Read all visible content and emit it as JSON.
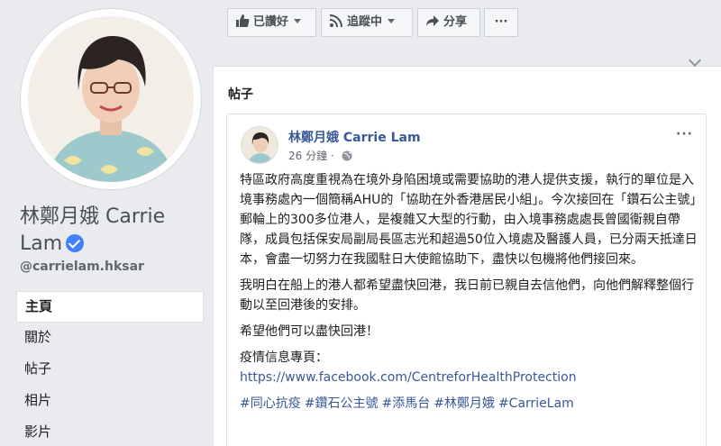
{
  "profile": {
    "name": "林鄭月娥 Carrie Lam",
    "name_line1": "林鄭月娥 Carrie",
    "name_line2": "Lam",
    "handle": "@carrielam.hksar"
  },
  "nav": {
    "items": [
      {
        "label": "主頁",
        "active": true
      },
      {
        "label": "關於"
      },
      {
        "label": "帖子"
      },
      {
        "label": "相片"
      },
      {
        "label": "影片"
      }
    ]
  },
  "actions": {
    "liked_label": "已讚好",
    "following_label": "追蹤中",
    "share_label": "分享",
    "more_label": "···"
  },
  "feed": {
    "title": "帖子"
  },
  "post": {
    "author": "林鄭月娥 Carrie Lam",
    "time": "26 分鐘",
    "meta_separator": "·",
    "more_label": "···",
    "paragraphs": [
      "特區政府高度重視為在境外身陷困境或需要協助的港人提供支援，執行的單位是入境事務處內一個簡稱AHU的「協助在外香港居民小組」。今次接回在「鑽石公主號」郵輪上的300多位港人，是複雜又大型的行動，由入境事務處處長曾國衞親自帶隊，成員包括保安局副局長區志光和超過50位入境處及醫護人員，已分兩天抵達日本，會盡一切努力在我國駐日大使館協助下，盡快以包機將他們接回來。",
      "我明白在船上的港人都希望盡快回港，我日前已親自去信他們，向他們解釋整個行動以至回港後的安排。",
      "希望他們可以盡快回港！"
    ],
    "info_label": "疫情信息專頁：",
    "link": "https://www.facebook.com/CentreforHealthProtection",
    "hashtags": [
      "#同心抗疫",
      "#鑽石公主號",
      "#添馬台",
      "#林鄭月娥",
      "#CarrieLam"
    ]
  },
  "colors": {
    "link": "#385898",
    "verified": "#4080ff",
    "background": "#e9ebee"
  },
  "icons": [
    "thumbs-up-icon",
    "rss-follow-icon",
    "share-arrow-icon",
    "globe-icon",
    "verified-badge-icon",
    "chevron-down-icon"
  ]
}
